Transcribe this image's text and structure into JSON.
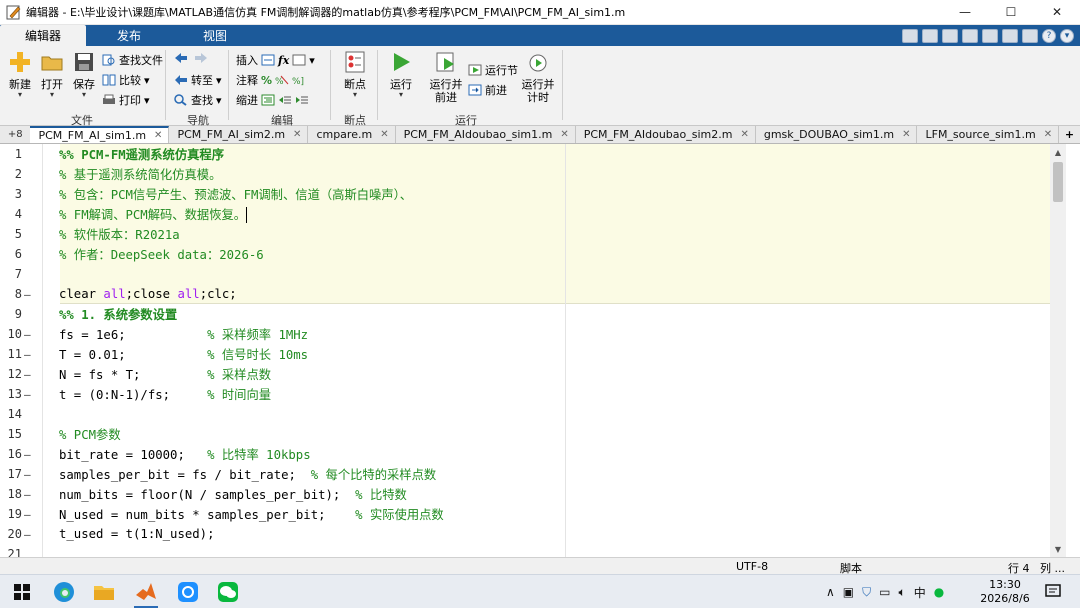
{
  "window": {
    "title": "编辑器 - E:\\毕业设计\\课题库\\MATLAB通信仿真  FM调制解调器的matlab仿真\\参考程序\\PCM_FM\\AI\\PCM_FM_AI_sim1.m",
    "minimize": "—",
    "maximize": "☐",
    "close": "✕"
  },
  "ribbon_tabs": [
    "编辑器",
    "发布",
    "视图"
  ],
  "ribbon": {
    "file": {
      "new": "新建",
      "open": "打开",
      "save": "保存",
      "find_files": "查找文件",
      "compare": "比较",
      "print": "打印",
      "group": "文件"
    },
    "navigate": {
      "goto": "转至",
      "find": "查找",
      "group": "导航"
    },
    "edit": {
      "insert": "插入",
      "comment": "注释",
      "indent": "缩进",
      "group": "编辑"
    },
    "breakpoints": {
      "breakpoints": "断点",
      "group": "断点"
    },
    "run": {
      "run": "运行",
      "run_advance_1": "运行并",
      "run_advance_2": "前进",
      "run_section": "运行节",
      "advance": "前进",
      "run_time_1": "运行并",
      "run_time_2": "计时",
      "group": "运行"
    }
  },
  "file_tabs": {
    "plus": "+8",
    "items": [
      "PCM_FM_AI_sim1.m",
      "PCM_FM_AI_sim2.m",
      "cmpare.m",
      "PCM_FM_AIdoubao_sim1.m",
      "PCM_FM_AIdoubao_sim2.m",
      "gmsk_DOUBAO_sim1.m",
      "LFM_source_sim1.m"
    ],
    "close": "✕",
    "add": "+"
  },
  "editor": {
    "lines": [
      {
        "n": "1",
        "dash": "",
        "text": "%% PCM-FM遥测系统仿真程序"
      },
      {
        "n": "2",
        "dash": "",
        "text": "% 基于遥测系统简化仿真模。"
      },
      {
        "n": "3",
        "dash": "",
        "text": "% 包含：PCM信号产生、预滤波、FM调制、信道（高斯白噪声）、"
      },
      {
        "n": "4",
        "dash": "",
        "text": "% FM解调、PCM解码、数据恢复。"
      },
      {
        "n": "5",
        "dash": "",
        "text": "% 软件版本：R2021a"
      },
      {
        "n": "6",
        "dash": "",
        "text": "% 作者：DeepSeek data：2026-6"
      },
      {
        "n": "7",
        "dash": "",
        "text": ""
      },
      {
        "n": "8",
        "dash": "—",
        "text": "clear all;close all;clc;"
      },
      {
        "n": "9",
        "dash": "",
        "text": "%% 1. 系统参数设置"
      },
      {
        "n": "10",
        "dash": "—",
        "text": "fs = 1e6;           % 采样频率 1MHz"
      },
      {
        "n": "11",
        "dash": "—",
        "text": "T = 0.01;           % 信号时长 10ms"
      },
      {
        "n": "12",
        "dash": "—",
        "text": "N = fs * T;         % 采样点数"
      },
      {
        "n": "13",
        "dash": "—",
        "text": "t = (0:N-1)/fs;     % 时间向量"
      },
      {
        "n": "14",
        "dash": "",
        "text": ""
      },
      {
        "n": "15",
        "dash": "",
        "text": "% PCM参数"
      },
      {
        "n": "16",
        "dash": "—",
        "text": "bit_rate = 10000;   % 比特率 10kbps"
      },
      {
        "n": "17",
        "dash": "—",
        "text": "samples_per_bit = fs / bit_rate;  % 每个比特的采样点数"
      },
      {
        "n": "18",
        "dash": "—",
        "text": "num_bits = floor(N / samples_per_bit);  % 比特数"
      },
      {
        "n": "19",
        "dash": "—",
        "text": "N_used = num_bits * samples_per_bit;    % 实际使用点数"
      },
      {
        "n": "20",
        "dash": "—",
        "text": "t_used = t(1:N_used);"
      },
      {
        "n": "21",
        "dash": "",
        "text": ""
      }
    ]
  },
  "statusbar": {
    "encoding": "UTF-8",
    "type": "脚本",
    "row": "行 4",
    "col": "列 ..."
  },
  "taskbar": {
    "ime": "中",
    "time": "13:30",
    "date": "2026/8/6"
  }
}
